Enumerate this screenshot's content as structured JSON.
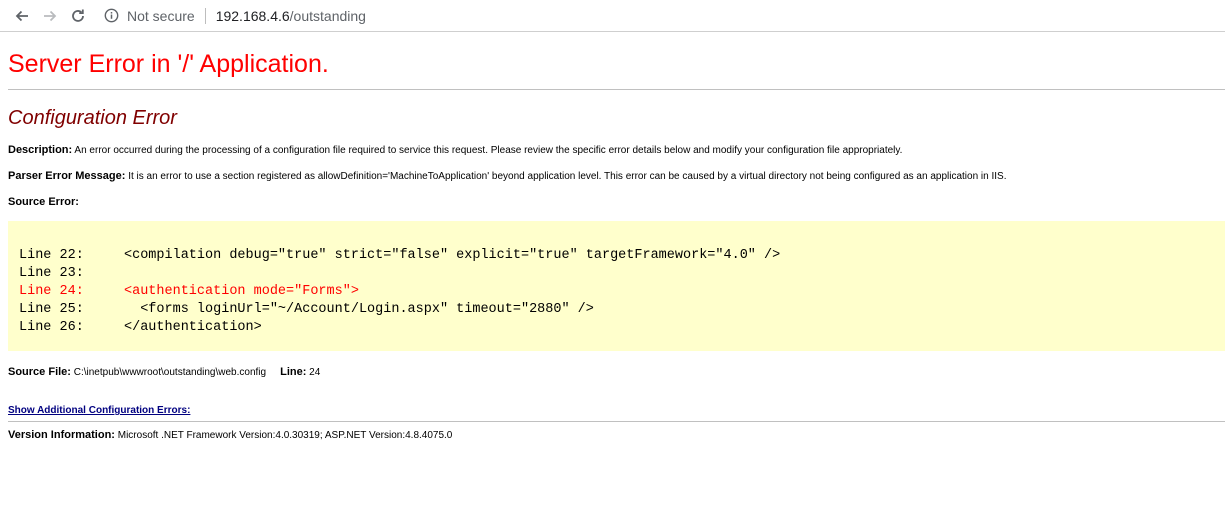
{
  "browser": {
    "security_label": "Not secure",
    "url_host": "192.168.4.6",
    "url_path": "/outstanding"
  },
  "page": {
    "app_title": "Server Error in '/' Application.",
    "error_title": "Configuration Error",
    "description_label": "Description:",
    "description_text": "An error occurred during the processing of a configuration file required to service this request. Please review the specific error details below and modify your configuration file appropriately.",
    "parser_label": "Parser Error Message:",
    "parser_text": "It is an error to use a section registered as allowDefinition='MachineToApplication' beyond application level.  This error can be caused by a virtual directory not being configured as an application in IIS.",
    "source_error_label": "Source Error:",
    "code_lines": [
      {
        "num": "Line 22:",
        "code": "<compilation debug=\"true\" strict=\"false\" explicit=\"true\" targetFramework=\"4.0\" />"
      },
      {
        "num": "Line 23:",
        "code": ""
      },
      {
        "num": "Line 24:",
        "code": "<authentication mode=\"Forms\">"
      },
      {
        "num": "Line 25:",
        "code": "  <forms loginUrl=\"~/Account/Login.aspx\" timeout=\"2880\" />"
      },
      {
        "num": "Line 26:",
        "code": "</authentication>"
      }
    ],
    "source_file_label": "Source File:",
    "source_file_value": "C:\\inetpub\\wwwroot\\outstanding\\web.config",
    "line_label": "Line:",
    "line_value": "24",
    "additional_link": "Show Additional Configuration Errors:",
    "version_label": "Version Information:",
    "version_text": "Microsoft .NET Framework Version:4.0.30319; ASP.NET Version:4.8.4075.0"
  },
  "colors": {
    "error_red": "#ff0000",
    "maroon": "#800000",
    "code_bg": "#ffffcc",
    "link": "#000080"
  }
}
